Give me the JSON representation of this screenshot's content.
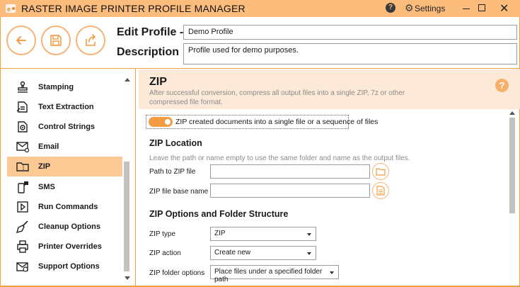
{
  "window": {
    "title": "RASTER IMAGE PRINTER PROFILE MANAGER",
    "help_icon": "?",
    "settings_label": "Settings",
    "close_icon": "✕"
  },
  "header": {
    "edit_label": "Edit Profile -",
    "description_label": "Description",
    "profile_name": "Demo Profile",
    "profile_description": "Profile used for demo purposes."
  },
  "sidebar": {
    "items": [
      {
        "label": "Stamping",
        "icon": "stamp-icon"
      },
      {
        "label": "Text Extraction",
        "icon": "text-extraction-icon"
      },
      {
        "label": "Control Strings",
        "icon": "control-strings-icon"
      },
      {
        "label": "Email",
        "icon": "email-icon"
      },
      {
        "label": "ZIP",
        "icon": "zip-icon",
        "selected": true
      },
      {
        "label": "SMS",
        "icon": "sms-icon"
      },
      {
        "label": "Run Commands",
        "icon": "run-commands-icon"
      },
      {
        "label": "Cleanup Options",
        "icon": "cleanup-icon"
      },
      {
        "label": "Printer Overrides",
        "icon": "printer-icon"
      },
      {
        "label": "Support Options",
        "icon": "support-icon"
      }
    ]
  },
  "main": {
    "title": "ZIP",
    "subtitle": "After successful conversion, compress all output files into a single ZIP, 7z or other compressed file format.",
    "help_icon": "?",
    "toggle_label": "ZIP created documents into a single file or a sequence of files",
    "toggle_on": true,
    "zip_location": {
      "heading": "ZIP Location",
      "note": "Leave the path or name empty to use the same folder and name as the output files.",
      "path_label": "Path to ZIP file",
      "path_value": "",
      "basename_label": "ZIP file base name",
      "basename_value": ""
    },
    "zip_options": {
      "heading": "ZIP Options and Folder Structure",
      "type_label": "ZIP type",
      "type_value": "ZIP",
      "action_label": "ZIP action",
      "action_value": "Create new",
      "folder_label": "ZIP folder options",
      "folder_value": "Place files under a specified folder path"
    }
  },
  "colors": {
    "accent": "#f39c43",
    "titlebar": "#fcbd7c",
    "selected": "#fcc995",
    "header_bg": "#fde9d8"
  }
}
